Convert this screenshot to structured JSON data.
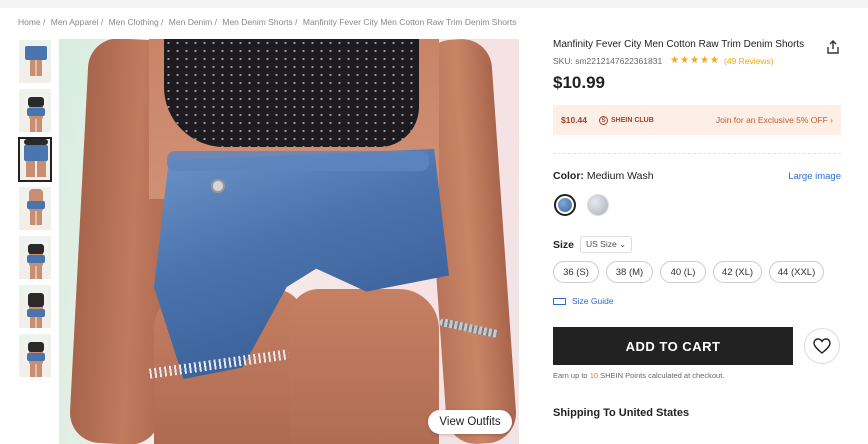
{
  "breadcrumb": [
    "Home /",
    "Men Apparel /",
    "Men Clothing /",
    "Men Denim /",
    "Men Denim Shorts /",
    "Manfinity Fever City Men Cotton Raw Trim Denim Shorts"
  ],
  "gallery": {
    "thumbnails": [
      "shorts-close",
      "full-body-front",
      "shorts-front-selected",
      "shorts-side",
      "full-body-walk",
      "crop-top-front",
      "full-body-side"
    ],
    "selected_index": 2,
    "view_outfits_label": "View Outfits"
  },
  "product": {
    "title": "Manfinity Fever City Men Cotton Raw Trim Denim Shorts",
    "sku": "SKU: sm2212147622361831",
    "stars": "★★★★★",
    "rating_count": "(49 Reviews)",
    "price": "$10.99"
  },
  "club": {
    "price": "$10.44",
    "logo": "SHEIN CLUB",
    "join_text": "Join for an Exclusive 5% OFF ›"
  },
  "color": {
    "label": "Color:",
    "value": "Medium Wash",
    "large_image": "Large image"
  },
  "size": {
    "label": "Size",
    "system": "US Size ⌄",
    "options": [
      "36 (S)",
      "38 (M)",
      "40 (L)",
      "42 (XL)",
      "44 (XXL)"
    ],
    "guide": "Size Guide"
  },
  "actions": {
    "add_to_cart": "ADD TO CART"
  },
  "points": {
    "prefix": "Earn up to ",
    "number": "10",
    "suffix": " SHEIN Points calculated at checkout."
  },
  "shipping": "Shipping To United States",
  "colors": {
    "accent": "#2c6ccf",
    "cart": "#222222",
    "club_bg": "#fdeee6",
    "star": "#f3a712"
  }
}
